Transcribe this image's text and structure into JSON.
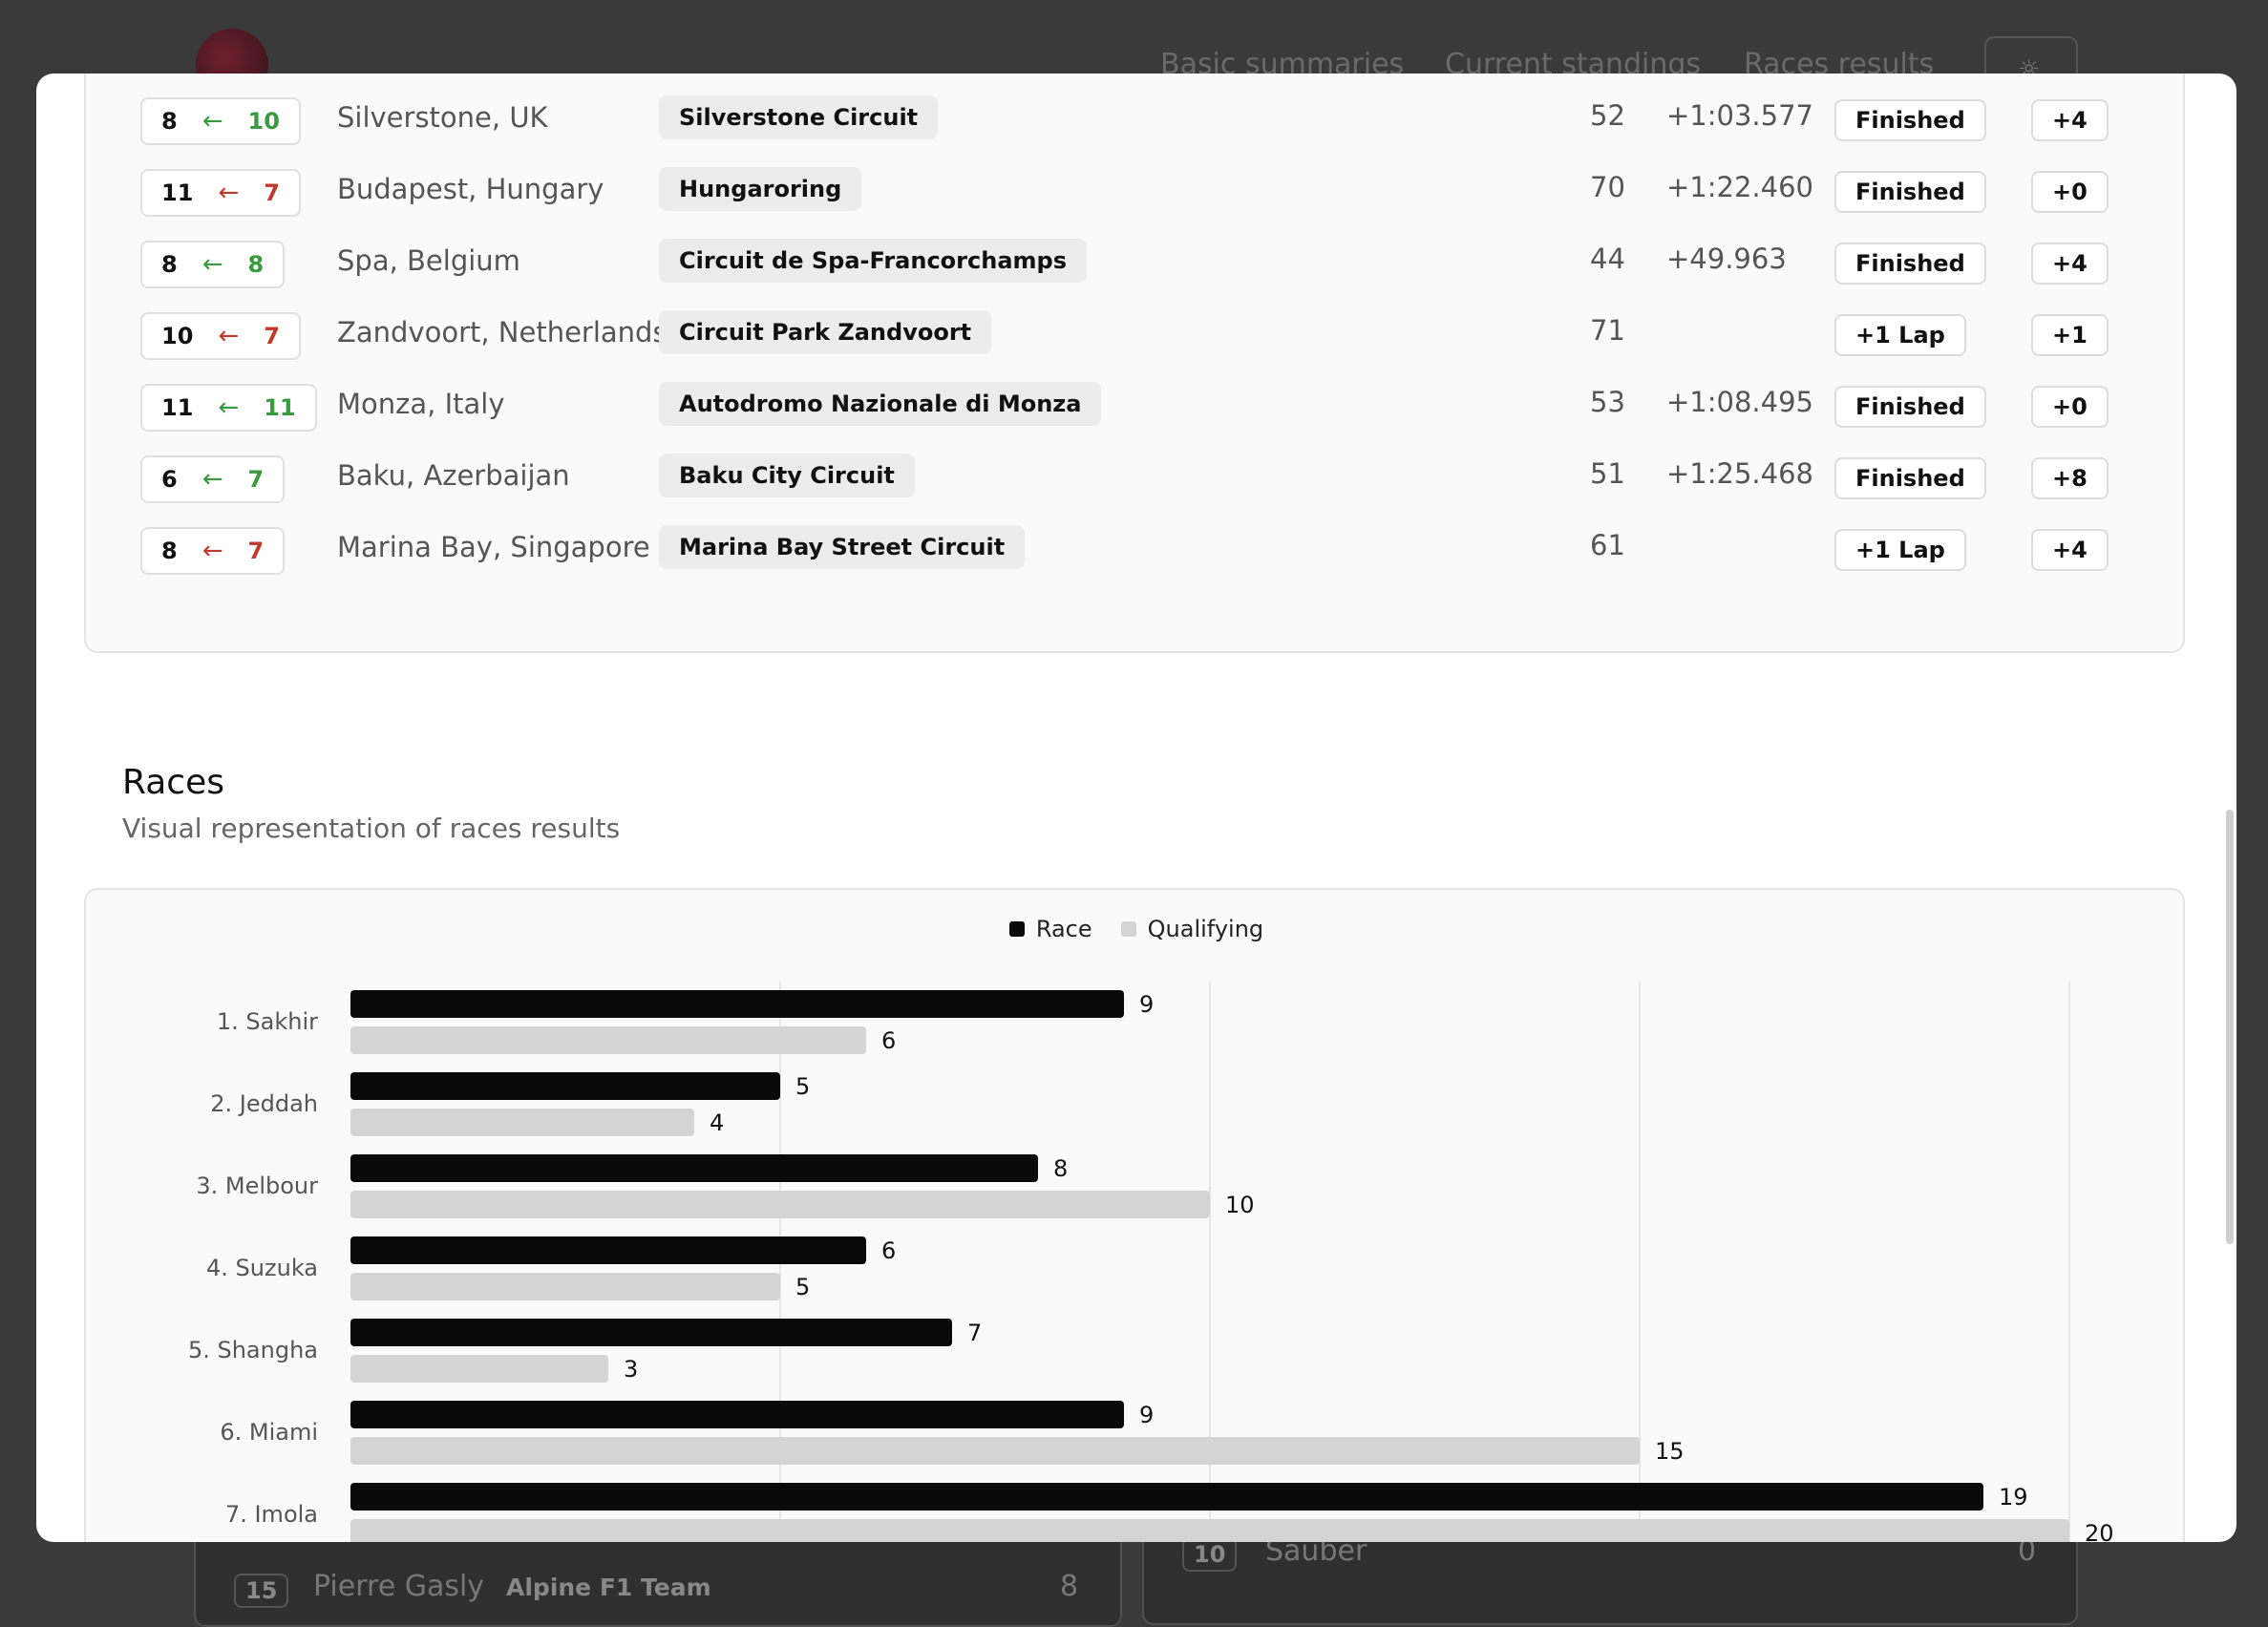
{
  "background": {
    "nav": [
      "Basic summaries",
      "Current standings",
      "Races results"
    ],
    "theme_icon": "sun-icon",
    "rows": [
      {
        "pos": "15",
        "driver": "Pierre Gasly",
        "team": "Alpine F1 Team",
        "points": "8"
      },
      {
        "pos": "10",
        "team": "Sauber",
        "points": "0"
      }
    ]
  },
  "races_table": {
    "rows": [
      {
        "finish": "8",
        "arrow": "←",
        "grid": "10",
        "trend": "up",
        "location": "Silverstone, UK",
        "circuit": "Silverstone Circuit",
        "laps": "52",
        "gap": "+1:03.577",
        "status": "Finished",
        "points": "+4"
      },
      {
        "finish": "11",
        "arrow": "←",
        "grid": "7",
        "trend": "down",
        "location": "Budapest, Hungary",
        "circuit": "Hungaroring",
        "laps": "70",
        "gap": "+1:22.460",
        "status": "Finished",
        "points": "+0"
      },
      {
        "finish": "8",
        "arrow": "←",
        "grid": "8",
        "trend": "up",
        "location": "Spa, Belgium",
        "circuit": "Circuit de Spa-Francorchamps",
        "laps": "44",
        "gap": "+49.963",
        "status": "Finished",
        "points": "+4"
      },
      {
        "finish": "10",
        "arrow": "←",
        "grid": "7",
        "trend": "down",
        "location": "Zandvoort, Netherlands",
        "circuit": "Circuit Park Zandvoort",
        "laps": "71",
        "gap": "",
        "status": "+1 Lap",
        "points": "+1"
      },
      {
        "finish": "11",
        "arrow": "←",
        "grid": "11",
        "trend": "up",
        "location": "Monza, Italy",
        "circuit": "Autodromo Nazionale di Monza",
        "laps": "53",
        "gap": "+1:08.495",
        "status": "Finished",
        "points": "+0"
      },
      {
        "finish": "6",
        "arrow": "←",
        "grid": "7",
        "trend": "up",
        "location": "Baku, Azerbaijan",
        "circuit": "Baku City Circuit",
        "laps": "51",
        "gap": "+1:25.468",
        "status": "Finished",
        "points": "+8"
      },
      {
        "finish": "8",
        "arrow": "←",
        "grid": "7",
        "trend": "down",
        "location": "Marina Bay, Singapore",
        "circuit": "Marina Bay Street Circuit",
        "laps": "61",
        "gap": "",
        "status": "+1 Lap",
        "points": "+4"
      }
    ]
  },
  "races_section": {
    "title": "Races",
    "subtitle": "Visual representation of races results"
  },
  "colors": {
    "race": "#0a0a0a",
    "qualifying": "#d4d4d4",
    "up": "#3a9a40",
    "down": "#c0392b"
  },
  "chart_data": {
    "type": "bar",
    "orientation": "horizontal",
    "categories": [
      "1. Sakhir",
      "2. Jeddah",
      "3. Melbour",
      "4. Suzuka",
      "5. Shangha",
      "6. Miami",
      "7. Imola"
    ],
    "series": [
      {
        "name": "Race",
        "values": [
          9,
          5,
          8,
          6,
          7,
          9,
          19
        ]
      },
      {
        "name": "Qualifying",
        "values": [
          6,
          4,
          10,
          5,
          3,
          15,
          20
        ]
      }
    ],
    "xlim": [
      0,
      20
    ],
    "grid": true,
    "legend": "top-center"
  }
}
